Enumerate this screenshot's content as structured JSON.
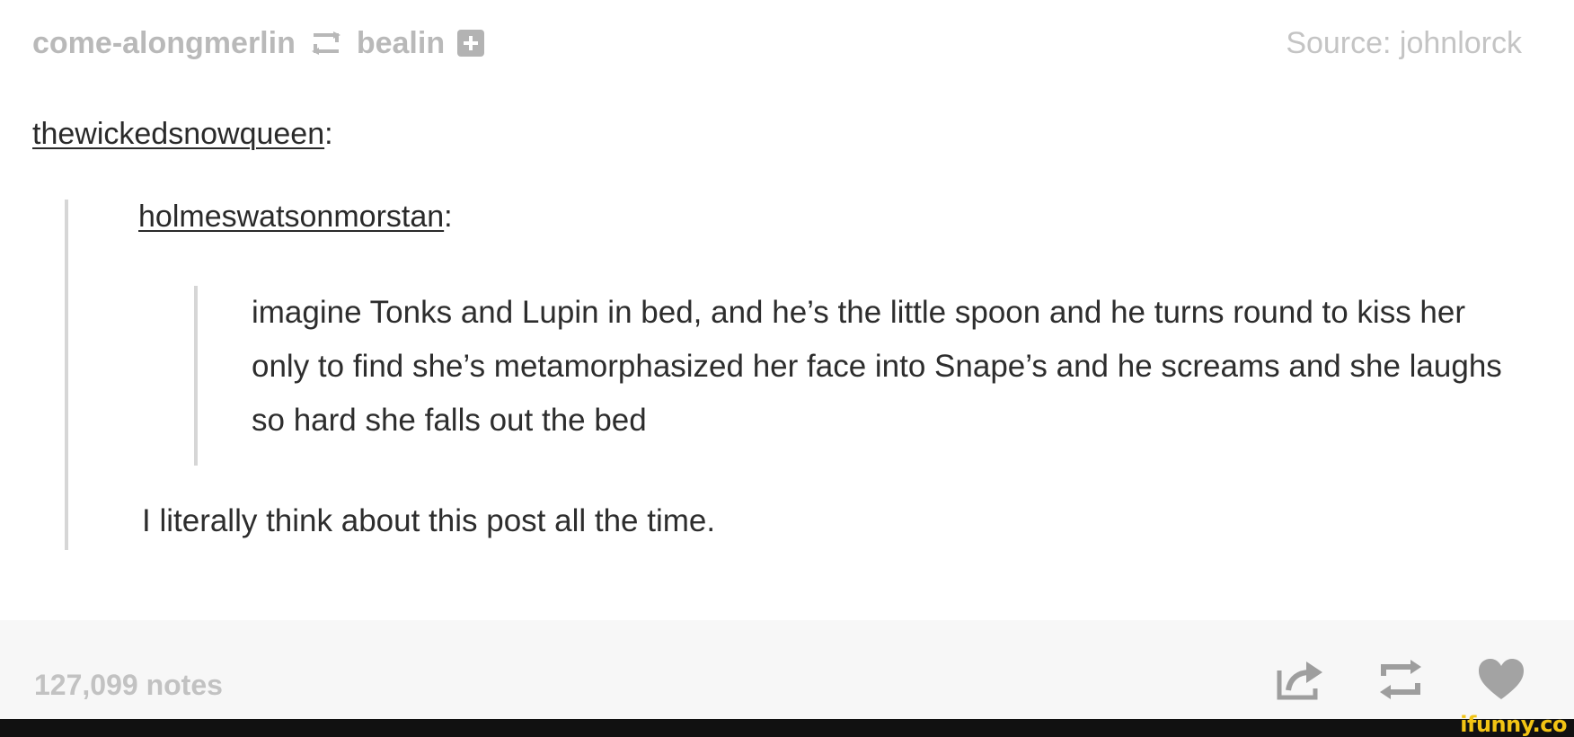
{
  "header": {
    "reblogged_from": "come-alongmerlin",
    "reblogger": "bealin",
    "source": "Source: johnlorck"
  },
  "body": {
    "outer_user": "thewickedsnowqueen",
    "inner_user": "holmeswatsonmorstan",
    "colon": ":",
    "quote_text": "imagine Tonks and Lupin in bed, and he’s the little spoon and he turns round to kiss her only to find she’s metamorphasized her face into Snape’s and he screams and she laughs so hard she falls out the bed",
    "comment": "I literally think about this post all the time."
  },
  "footer": {
    "notes": "127,099 notes"
  },
  "icons": {
    "reblog": "reblog-icon",
    "follow": "follow-plus-icon",
    "share": "share-icon",
    "repost": "reblog-icon",
    "like": "heart-icon"
  },
  "colors": {
    "muted_text": "#b9b9b9",
    "body_text": "#2d2d2d",
    "quote_rule": "#d6d6d6",
    "footer_bg": "#f7f7f7",
    "watermark": "#f2c414"
  },
  "watermark": "ifunny.co"
}
